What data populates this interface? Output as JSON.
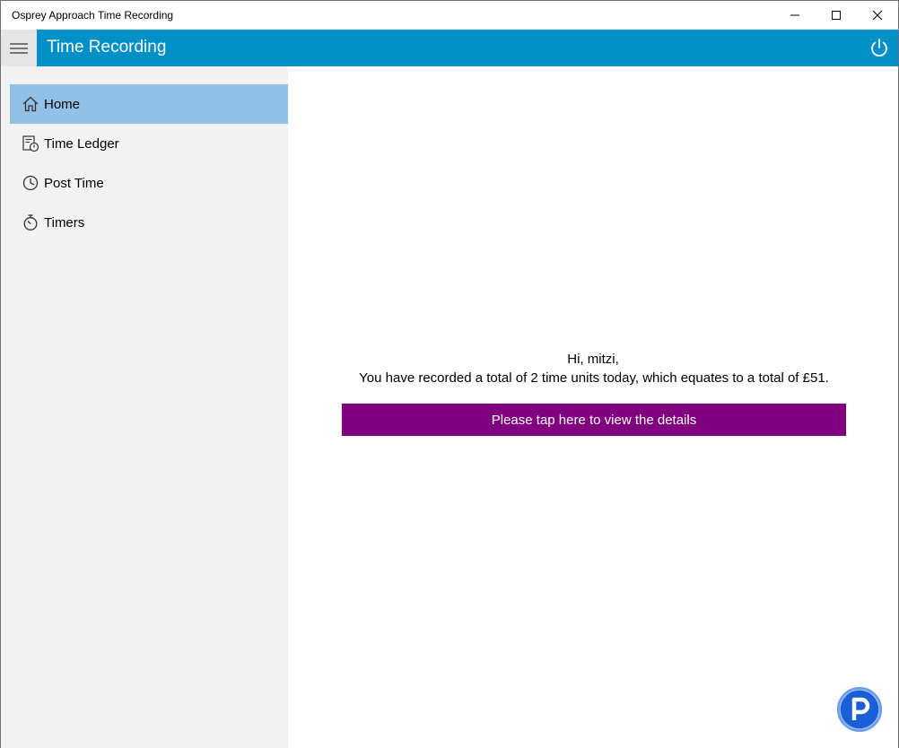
{
  "window": {
    "title": "Osprey Approach Time Recording",
    "controls": {
      "minimize_icon": "minimize-icon",
      "maximize_icon": "maximize-icon",
      "close_icon": "close-icon"
    }
  },
  "appbar": {
    "title": "Time Recording",
    "menu_icon": "hamburger-icon",
    "power_icon": "power-icon",
    "color": "#0090c8"
  },
  "sidebar": {
    "items": [
      {
        "label": "Home",
        "icon": "home-icon",
        "selected": true
      },
      {
        "label": "Time Ledger",
        "icon": "ledger-icon",
        "selected": false
      },
      {
        "label": "Post Time",
        "icon": "clock-icon",
        "selected": false
      },
      {
        "label": "Timers",
        "icon": "stopwatch-icon",
        "selected": false
      }
    ],
    "selected_color": "#92c1e8"
  },
  "main": {
    "greeting": "Hi, mitzi,",
    "summary": "You have recorded a total of 2 time units today, which equates to a total of £51.",
    "details_button": "Please tap here to view the details",
    "details_button_color": "#800080"
  },
  "badge": {
    "icon": "p-logo-icon",
    "letter": "P"
  }
}
